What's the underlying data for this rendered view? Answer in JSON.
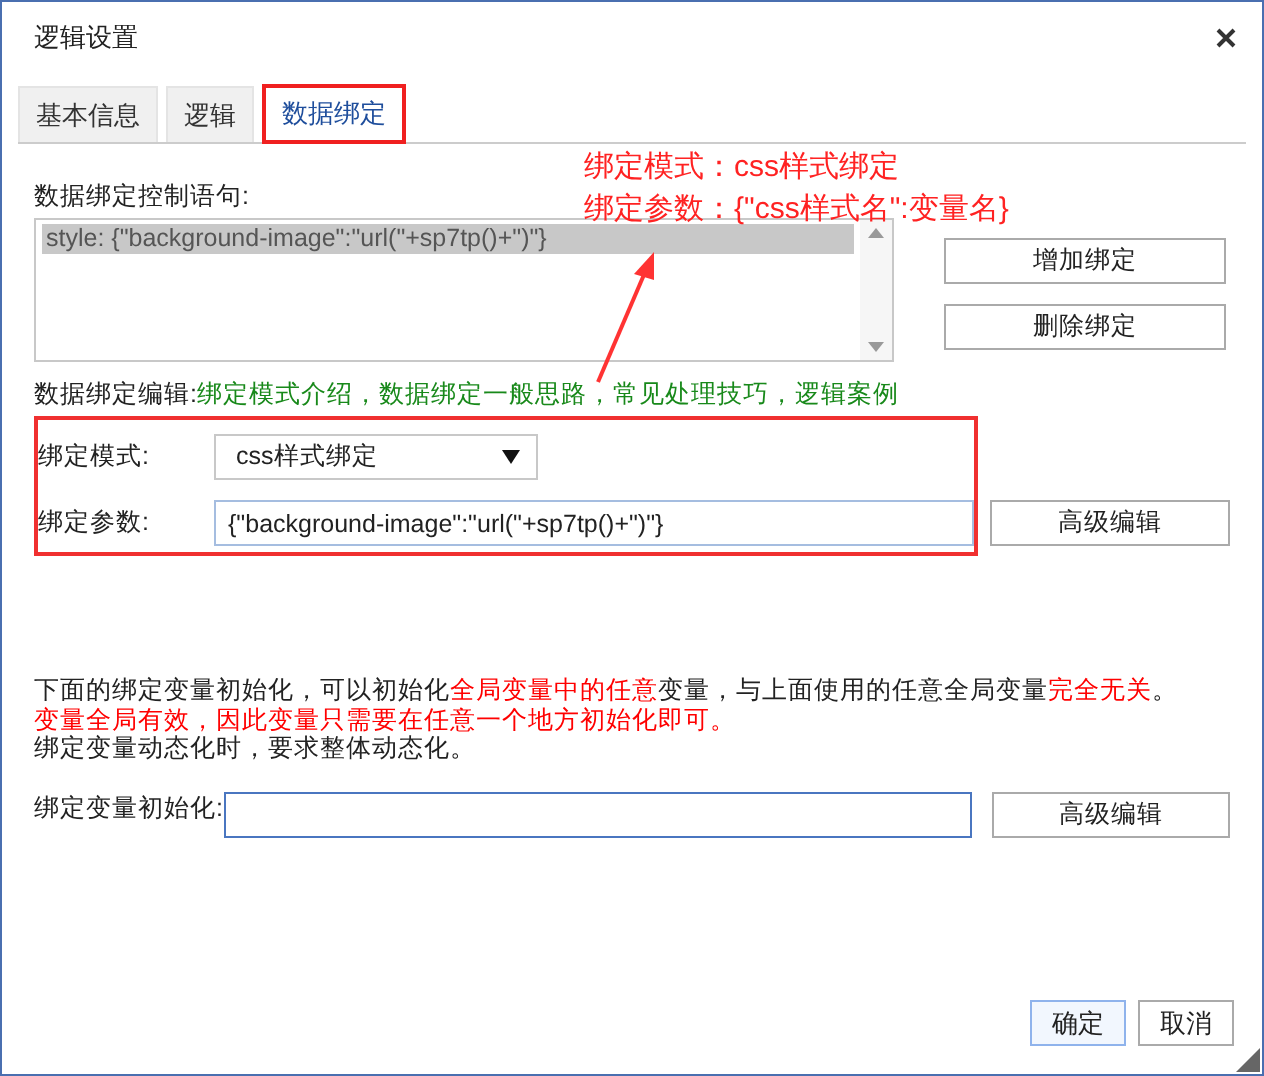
{
  "window": {
    "title": "逻辑设置"
  },
  "tabs": [
    {
      "label": "基本信息",
      "selected": false
    },
    {
      "label": "逻辑",
      "selected": false
    },
    {
      "label": "数据绑定",
      "selected": true
    }
  ],
  "annotation": {
    "lines": [
      "绑定模式：css样式绑定",
      "绑定参数：{\"css样式名\":变量名}"
    ]
  },
  "binding_statements": {
    "label": "数据绑定控制语句:",
    "items": [
      {
        "text": "style: {\"background-image\":\"url(\"+sp7tp()+\")\"}",
        "selected": true
      }
    ]
  },
  "side_buttons": [
    "增加绑定",
    "删除绑定"
  ],
  "edit_links": {
    "label": "数据绑定编辑:",
    "separator": "，",
    "links": [
      "绑定模式介绍",
      "数据绑定一般思路",
      "常见处理技巧",
      "逻辑案例"
    ]
  },
  "mode": {
    "label": "绑定模式:",
    "value": "css样式绑定"
  },
  "param": {
    "label": "绑定参数:",
    "value": "{\"background-image\":\"url(\"+sp7tp()+\")\"}",
    "button": "高级编辑"
  },
  "notes": [
    {
      "segments": [
        {
          "text": "下面的绑定变量初始化，可以初始化",
          "highlight": false
        },
        {
          "text": "全局变量中的任意",
          "highlight": true
        },
        {
          "text": "变量，与上面使用的任意全局变量",
          "highlight": false
        },
        {
          "text": "完全无关",
          "highlight": true
        },
        {
          "text": "。",
          "highlight": false
        }
      ]
    },
    {
      "segments": [
        {
          "text": "变量全局有效，因此变量只需要在任意一个地方初始化即可。",
          "highlight": true
        }
      ]
    },
    {
      "segments": [
        {
          "text": "绑定变量动态化时，要求整体动态化。",
          "highlight": false
        }
      ]
    }
  ],
  "init": {
    "label": "绑定变量初始化:",
    "button": "高级编辑"
  },
  "footer_buttons": [
    {
      "label": "确定",
      "primary": true
    },
    {
      "label": "取消",
      "primary": false
    }
  ]
}
